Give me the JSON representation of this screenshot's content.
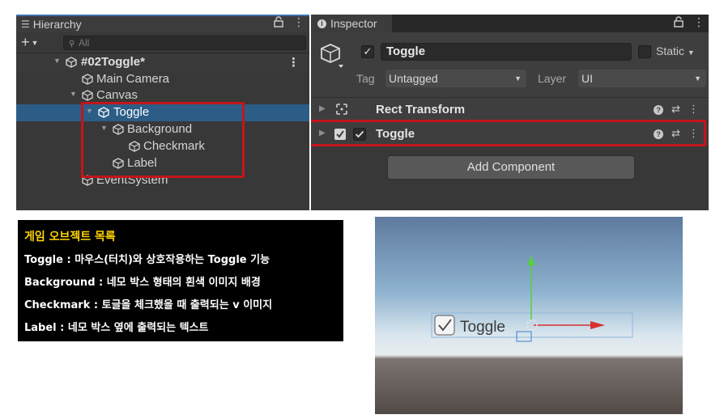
{
  "hierarchy": {
    "tab_label": "Hierarchy",
    "search_placeholder": "All",
    "scene_name": "#02Toggle*",
    "items": [
      {
        "label": "Main Camera"
      },
      {
        "label": "Canvas"
      },
      {
        "label": "Toggle"
      },
      {
        "label": "Background"
      },
      {
        "label": "Checkmark"
      },
      {
        "label": "Label"
      },
      {
        "label": "EventSystem"
      }
    ],
    "selected_item": "Toggle"
  },
  "inspector": {
    "tab_label": "Inspector",
    "object_name": "Toggle",
    "static_label": "Static",
    "tag_label": "Tag",
    "tag_value": "Untagged",
    "layer_label": "Layer",
    "layer_value": "UI",
    "components": [
      {
        "name": "Rect Transform"
      },
      {
        "name": "Toggle"
      }
    ],
    "add_component_label": "Add Component"
  },
  "caption": {
    "title": "게임 오브젝트 목록",
    "lines": [
      "Toggle : 마우스(터치)와 상호작용하는 Toggle 기능",
      "Background : 네모 박스 형태의 흰색 이미지 배경",
      "Checkmark : 토글을 체크했을 때 출력되는 v 이미지",
      "Label : 네모 박스 옆에 출력되는 텍스트"
    ]
  },
  "scene_view": {
    "toggle_label": "Toggle",
    "toggle_checked": true
  },
  "colors": {
    "highlight_red": "#c3151b",
    "selection_blue": "#2c5d87",
    "caption_title_yellow": "#ffd400"
  }
}
